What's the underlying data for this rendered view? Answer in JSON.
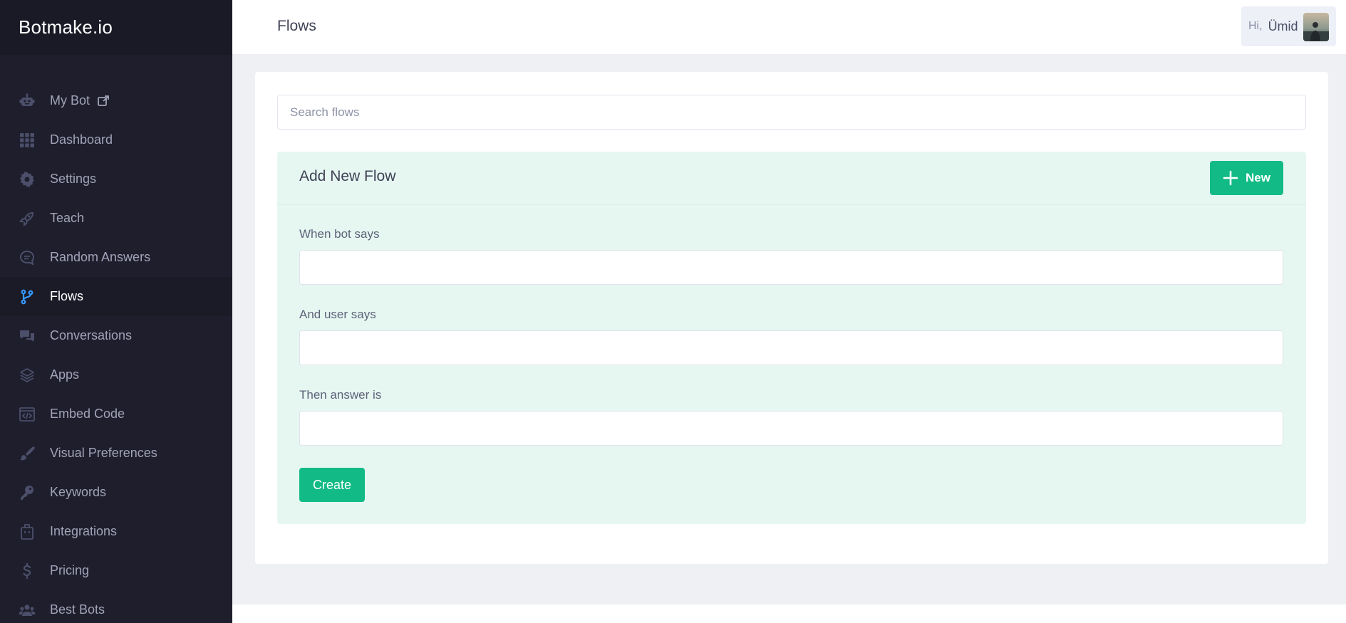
{
  "brand": "Botmake.io",
  "sidebar": {
    "items": [
      {
        "label": "My Bot",
        "icon": "robot-icon",
        "active": false,
        "external": true
      },
      {
        "label": "Dashboard",
        "icon": "grid-icon",
        "active": false
      },
      {
        "label": "Settings",
        "icon": "gear-icon",
        "active": false
      },
      {
        "label": "Teach",
        "icon": "rocket-icon",
        "active": false
      },
      {
        "label": "Random Answers",
        "icon": "chat-bubble-icon",
        "active": false
      },
      {
        "label": "Flows",
        "icon": "git-branch-icon",
        "active": true
      },
      {
        "label": "Conversations",
        "icon": "comments-icon",
        "active": false
      },
      {
        "label": "Apps",
        "icon": "layers-icon",
        "active": false
      },
      {
        "label": "Embed Code",
        "icon": "code-window-icon",
        "active": false
      },
      {
        "label": "Visual Preferences",
        "icon": "brush-icon",
        "active": false
      },
      {
        "label": "Keywords",
        "icon": "key-icon",
        "active": false
      },
      {
        "label": "Integrations",
        "icon": "box-icon",
        "active": false
      },
      {
        "label": "Pricing",
        "icon": "dollar-icon",
        "active": false
      },
      {
        "label": "Best Bots",
        "icon": "users-icon",
        "active": false
      }
    ]
  },
  "header": {
    "title": "Flows",
    "greeting": "Hi,",
    "user_name": "Ümid"
  },
  "search": {
    "placeholder": "Search flows"
  },
  "new_flow": {
    "title": "Add New Flow",
    "new_button": "New",
    "fields": [
      {
        "label": "When bot says",
        "value": ""
      },
      {
        "label": "And user says",
        "value": ""
      },
      {
        "label": "Then answer is",
        "value": ""
      }
    ],
    "create_button": "Create"
  },
  "colors": {
    "sidebar_bg": "#1e1e2d",
    "accent_green": "#12bb85",
    "active_icon": "#3699ff",
    "panel_bg": "#e6f7f2"
  }
}
